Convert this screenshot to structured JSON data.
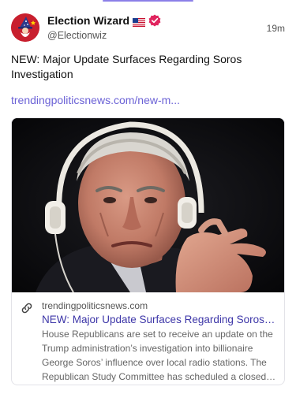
{
  "post": {
    "author": {
      "display_name": "Election Wizard",
      "handle": "@Electionwiz",
      "flag_icon": "us-flag-icon",
      "verified_icon": "verified-badge-icon",
      "verified_color": "#e0245e"
    },
    "timestamp": "19m",
    "text": "NEW: Major Update Surfaces Regarding Soros Investigation",
    "link_text": "trendingpoliticsnews.com/new-m...",
    "link_color": "#6b62d6",
    "card": {
      "domain": "trendingpoliticsnews.com",
      "title": "NEW: Major Update Surfaces Regarding Soros Investigation",
      "description": "House Republicans are set to receive an update on the Trump administration’s investigation into billionaire George Soros’ influence over local radio stations. The Republican Study Committee has scheduled a closed-door briefing.",
      "link_icon": "link-icon",
      "title_color": "#3d36a8"
    }
  }
}
